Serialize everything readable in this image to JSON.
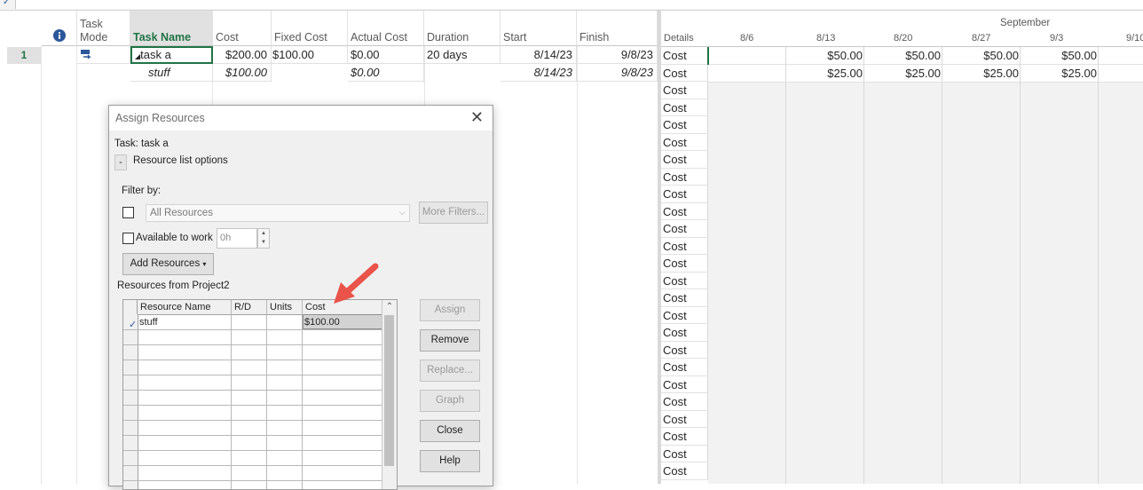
{
  "grid": {
    "headers": [
      {
        "key": "info",
        "label": "",
        "icon": "info-icon"
      },
      {
        "key": "mode",
        "label": "Task Mode"
      },
      {
        "key": "name",
        "label": "Task Name"
      },
      {
        "key": "cost",
        "label": "Cost"
      },
      {
        "key": "fixed",
        "label": "Fixed Cost"
      },
      {
        "key": "actual",
        "label": "Actual Cost"
      },
      {
        "key": "duration",
        "label": "Duration"
      },
      {
        "key": "start",
        "label": "Start"
      },
      {
        "key": "finish",
        "label": "Finish"
      }
    ],
    "rows": [
      {
        "num": "1",
        "name": "task a",
        "cost": "$200.00",
        "fixed": "$100.00",
        "actual": "$0.00",
        "duration": "20 days",
        "start": "8/14/23",
        "finish": "9/8/23"
      },
      {
        "num": "",
        "name": "stuff",
        "cost": "$100.00",
        "fixed": "",
        "actual": "$0.00",
        "duration": "",
        "start": "8/14/23",
        "finish": "9/8/23"
      }
    ]
  },
  "timephased": {
    "month": "September",
    "details_label": "Details",
    "weeks": [
      "8/6",
      "8/13",
      "8/20",
      "8/27",
      "9/3",
      "9/10"
    ],
    "row_label": "Cost",
    "values": [
      [
        "",
        "$50.00",
        "$50.00",
        "$50.00",
        "$50.00"
      ],
      [
        "",
        "$25.00",
        "$25.00",
        "$25.00",
        "$25.00"
      ]
    ]
  },
  "dialog": {
    "title": "Assign Resources",
    "task_line": "Task: task a",
    "collapse_symbol": "-",
    "resource_list_options": "Resource list options",
    "filter_by": "Filter by:",
    "filter_value": "All Resources",
    "more_filters": "More Filters...",
    "available_to_work": "Available to work",
    "available_value": "0h",
    "add_resources": "Add Resources",
    "resources_from": "Resources from Project2",
    "table_headers": [
      "Resource Name",
      "R/D",
      "Units",
      "Cost"
    ],
    "table_rows": [
      {
        "name": "stuff",
        "rd": "",
        "units": "",
        "cost": "$100.00"
      }
    ],
    "buttons": {
      "assign": "Assign",
      "remove": "Remove",
      "replace": "Replace...",
      "graph": "Graph",
      "close": "Close",
      "help": "Help"
    },
    "close_glyph": "✕"
  },
  "colors": {
    "accent": "#217346",
    "arrow": "#e9534a"
  }
}
